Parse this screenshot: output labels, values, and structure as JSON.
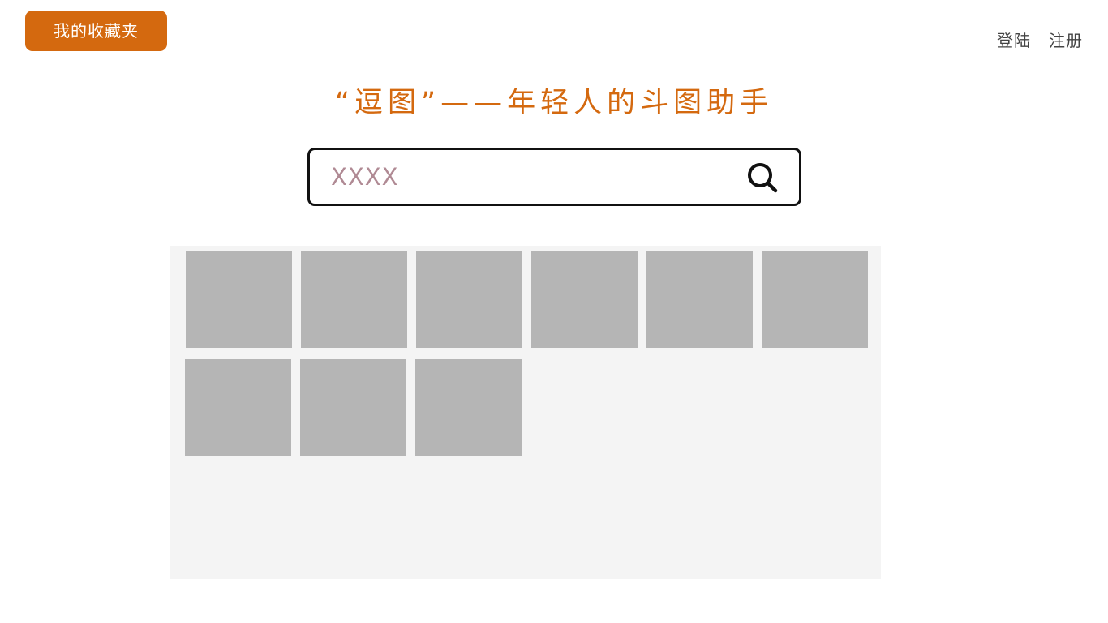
{
  "header": {
    "favorites_label": "我的收藏夹",
    "login_label": "登陆",
    "register_label": "注册"
  },
  "title": "“逗图”——年轻人的斗图助手",
  "search": {
    "placeholder": "XXXX",
    "value": ""
  },
  "results": {
    "item_count": 9,
    "thumbnail_color": "#b5b5b5"
  },
  "colors": {
    "accent": "#d4690f",
    "panel_background": "#f4f4f4"
  },
  "icons": {
    "search": "search-icon"
  }
}
